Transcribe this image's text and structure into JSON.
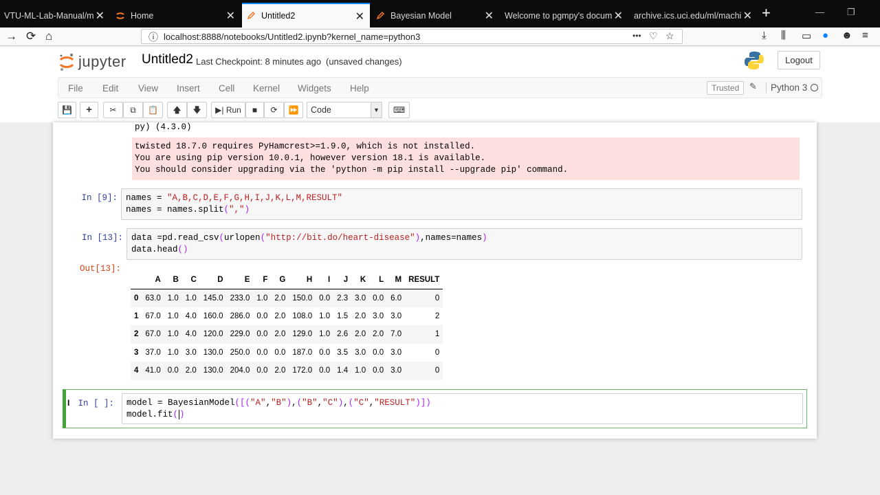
{
  "browser": {
    "tabs": [
      {
        "title": "VTU-ML-Lab-Manual/m",
        "active": false
      },
      {
        "title": "Home",
        "active": false
      },
      {
        "title": "Untitled2",
        "active": true
      },
      {
        "title": "Bayesian Model",
        "active": false
      },
      {
        "title": "Welcome to pgmpy's docum",
        "active": false
      },
      {
        "title": "archive.ics.uci.edu/ml/machi",
        "active": false
      }
    ],
    "url": "localhost:8888/notebooks/Untitled2.ipynb?kernel_name=python3",
    "url_menu": "•••"
  },
  "jupyter": {
    "logo_text": "jupyter",
    "notebook_name": "Untitled2",
    "checkpoint": "Last Checkpoint: 8 minutes ago",
    "autosave": "(unsaved changes)",
    "logout_label": "Logout",
    "menu": [
      "File",
      "Edit",
      "View",
      "Insert",
      "Cell",
      "Kernel",
      "Widgets",
      "Help"
    ],
    "trusted_label": "Trusted",
    "kernel_name": "Python 3",
    "run_label": "Run",
    "cell_type": "Code"
  },
  "cells": {
    "partial_output": "py) (4.3.0)",
    "stderr": [
      "twisted 18.7.0 requires PyHamcrest>=1.9.0, which is not installed.",
      "You are using pip version 10.0.1, however version 18.1 is available.",
      "You should consider upgrading via the 'python -m pip install --upgrade pip' command."
    ],
    "cell9_prompt": "In [9]:",
    "cell13_prompt": "In [13]:",
    "out13_prompt": "Out[13]:",
    "active_prompt": "In [ ]:"
  },
  "dataframe": {
    "columns": [
      "",
      "A",
      "B",
      "C",
      "D",
      "E",
      "F",
      "G",
      "H",
      "I",
      "J",
      "K",
      "L",
      "M",
      "RESULT"
    ],
    "rows": [
      [
        "0",
        "63.0",
        "1.0",
        "1.0",
        "145.0",
        "233.0",
        "1.0",
        "2.0",
        "150.0",
        "0.0",
        "2.3",
        "3.0",
        "0.0",
        "6.0",
        "0"
      ],
      [
        "1",
        "67.0",
        "1.0",
        "4.0",
        "160.0",
        "286.0",
        "0.0",
        "2.0",
        "108.0",
        "1.0",
        "1.5",
        "2.0",
        "3.0",
        "3.0",
        "2"
      ],
      [
        "2",
        "67.0",
        "1.0",
        "4.0",
        "120.0",
        "229.0",
        "0.0",
        "2.0",
        "129.0",
        "1.0",
        "2.6",
        "2.0",
        "2.0",
        "7.0",
        "1"
      ],
      [
        "3",
        "37.0",
        "1.0",
        "3.0",
        "130.0",
        "250.0",
        "0.0",
        "0.0",
        "187.0",
        "0.0",
        "3.5",
        "3.0",
        "0.0",
        "3.0",
        "0"
      ],
      [
        "4",
        "41.0",
        "0.0",
        "2.0",
        "130.0",
        "204.0",
        "0.0",
        "2.0",
        "172.0",
        "0.0",
        "1.4",
        "1.0",
        "0.0",
        "3.0",
        "0"
      ]
    ]
  },
  "colors": {
    "prompt_in": "#303f9f",
    "prompt_out": "#d84315",
    "stderr_bg": "#fddfe0",
    "active_cell": "#42a535",
    "string": "#ba2121"
  }
}
